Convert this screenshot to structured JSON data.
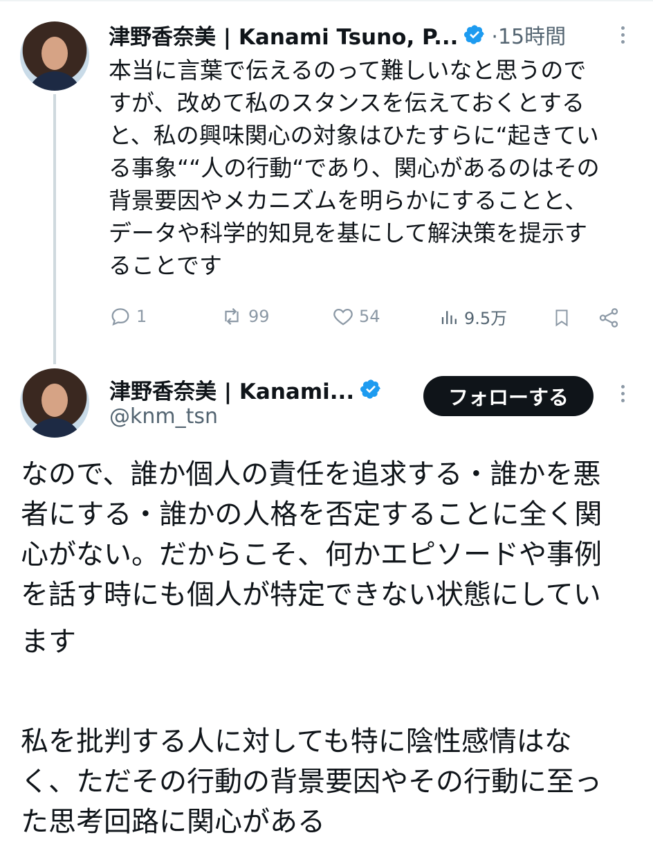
{
  "tweet1": {
    "name": "津野香奈美 | Kanami Tsuno, P...",
    "time": "·15時間",
    "text": "本当に言葉で伝えるのって難しいなと思うのですが、改めて私のスタンスを伝えておくとすると、私の興味関心の対象はひたすらに“起きている事象““人の行動“であり、関心があるのはその背景要因やメカニズムを明らかにすることと、データや科学的知見を基にして解決策を提示することです",
    "lines": [
      "本当に言葉で伝えるのって難しいなと思うので",
      "すが、改めて私のスタンスを伝えておくとする",
      "と、私の興味関心の対象はひたすらに“起きてい",
      "る事象““人の行動“であり、関心があるのはその",
      "背景要因やメカニズムを明らかにすることと、",
      "データや科学的知見を基にして解決策を提示す",
      "ることです"
    ],
    "replies": "1",
    "retweets": "99",
    "likes": "54",
    "views": "9.5万"
  },
  "tweet2": {
    "name": "津野香奈美 | Kanami...",
    "handle": "@knm_tsn",
    "follow_label": "フォローする",
    "lines": [
      "なので、誰か個人の責任を追求する・誰かを悪",
      "者にする・誰かの人格を否定することに全く関",
      "心がない。だからこそ、何かエピソードや事例",
      "を話す時にも個人が特定できない状態にしてい",
      "ます",
      "",
      "私を批判する人に対しても特に陰性感情はな",
      "く、ただその行動の背景要因やその行動に至っ",
      "た思考回路に関心がある"
    ]
  },
  "icons": {
    "verified": "verified-badge-icon",
    "more": "more-options-icon",
    "reply": "reply-icon",
    "retweet": "retweet-icon",
    "like": "heart-icon",
    "views": "views-chart-icon",
    "bookmark": "bookmark-icon",
    "share": "share-icon"
  },
  "colors": {
    "verified": "#1d9bf0",
    "text": "#0f1419",
    "muted": "#536471",
    "action": "#8b98a5"
  }
}
